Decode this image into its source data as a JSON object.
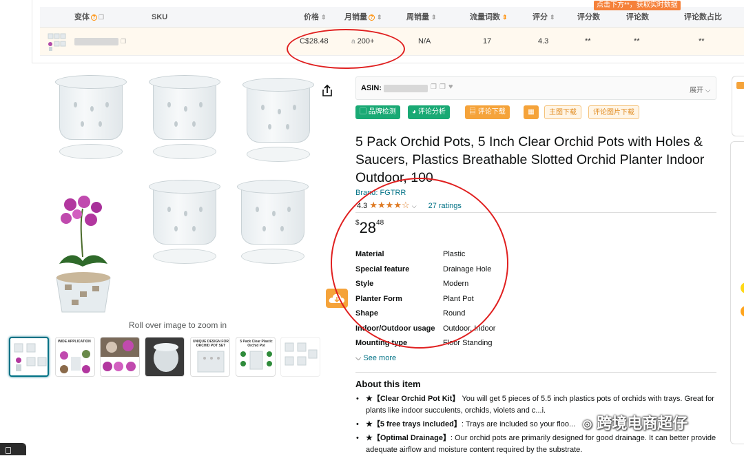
{
  "plugin": {
    "tip": "点击下方**，获取实时数据",
    "headers": {
      "variant": "变体",
      "sku": "SKU",
      "price": "价格",
      "monthly_sales": "月销量",
      "weekly_sales": "周销量",
      "traffic_words": "流量词数",
      "rating": "评分",
      "rating_count": "评分数",
      "review_count": "评论数",
      "review_ratio": "评论数占比"
    },
    "row": {
      "price": "C$28.48",
      "monthly_sales": "200+",
      "weekly_sales": "N/A",
      "traffic_words": "17",
      "rating": "4.3",
      "rating_count": "**",
      "review_count": "**",
      "review_ratio": "**"
    }
  },
  "gallery": {
    "zoom_hint": "Roll over image to zoom in",
    "thumbnails": [
      {
        "caption": ""
      },
      {
        "caption": "WIDE APPLICATION"
      },
      {
        "caption": ""
      },
      {
        "caption": ""
      },
      {
        "caption": "UNIQUE DESIGN FOR ORCHID POT SET"
      },
      {
        "caption": "5 Pack Clear Plastic Orchid Pot"
      },
      {
        "caption": ""
      }
    ]
  },
  "asin_bar": {
    "label": "ASIN:",
    "expand": "展开"
  },
  "tools": {
    "brand_check": "品牌检测",
    "review_analysis": "评论分析",
    "review_download": "评论下载",
    "main_image_download": "主图下载",
    "review_image_download": "评论图片下载"
  },
  "product": {
    "title": "5 Pack Orchid Pots, 5 Inch Clear Orchid Pots with Holes & Saucers, Plastics Breathable Slotted Orchid Planter Indoor Outdoor, 100",
    "brand": "Brand: FGTRR",
    "rating": "4.3",
    "ratings_count": "27 ratings",
    "price_symbol": "$",
    "price_whole": "28",
    "price_fraction": "48",
    "specs": [
      {
        "key": "Material",
        "value": "Plastic"
      },
      {
        "key": "Special feature",
        "value": "Drainage Hole"
      },
      {
        "key": "Style",
        "value": "Modern"
      },
      {
        "key": "Planter Form",
        "value": "Plant Pot"
      },
      {
        "key": "Shape",
        "value": "Round"
      },
      {
        "key": "Indoor/Outdoor usage",
        "value": "Outdoor, Indoor"
      },
      {
        "key": "Mounting type",
        "value": "Floor Standing"
      }
    ],
    "see_more": "See more",
    "about_title": "About this item",
    "bullets": [
      {
        "head": "★【Clear Orchid Pot Kit】",
        "text": " You will get 5 pieces of 5.5 inch plastics pots of orchids with trays. Great for plants like indoor succulents, orchids, violets and c...i."
      },
      {
        "head": "★【5 free trays included】",
        "text": ": Trays are included so your floo..."
      },
      {
        "head": "★【Optimal Drainage】",
        "text": ": Our orchid pots are primarily designed for good drainage. It can better provide adequate airflow and moisture content required by the substrate."
      }
    ]
  },
  "watermark": "跨境电商超仔",
  "colors": {
    "accent_orange": "#f5813a",
    "link": "#007185",
    "star": "#de7921",
    "annotation_red": "#e02020",
    "btn_green": "#19a974",
    "btn_orange": "#f5a33a"
  }
}
